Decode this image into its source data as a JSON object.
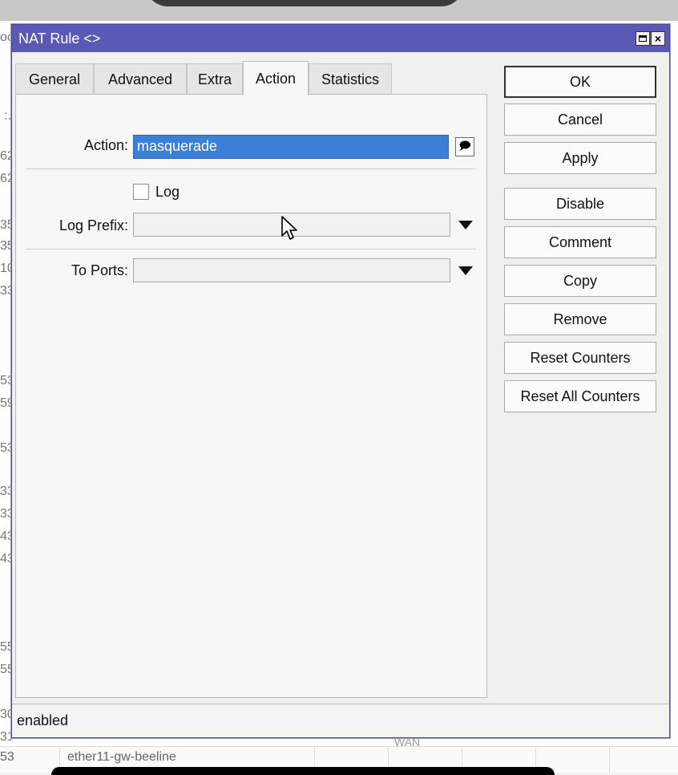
{
  "window": {
    "title": "NAT Rule <>",
    "close_glyph": "×"
  },
  "tabs": [
    {
      "label": "General",
      "active": false
    },
    {
      "label": "Advanced",
      "active": false
    },
    {
      "label": "Extra",
      "active": false
    },
    {
      "label": "Action",
      "active": true
    },
    {
      "label": "Statistics",
      "active": false
    }
  ],
  "form": {
    "action_label": "Action:",
    "action_value": "masquerade",
    "log_label": "Log",
    "log_checked": false,
    "log_prefix_label": "Log Prefix:",
    "log_prefix_value": "",
    "to_ports_label": "To Ports:",
    "to_ports_value": ""
  },
  "buttons": {
    "ok": "OK",
    "cancel": "Cancel",
    "apply": "Apply",
    "disable": "Disable",
    "comment": "Comment",
    "copy": "Copy",
    "remove": "Remove",
    "reset_counters": "Reset Counters",
    "reset_all_counters": "Reset All Counters"
  },
  "status": {
    "text": "enabled"
  },
  "background": {
    "left_stubs": [
      "oc",
      ":.",
      "62",
      "62",
      "35",
      "35",
      "10",
      "33",
      "53",
      "59",
      "53",
      "33",
      "33",
      "43",
      "43",
      "55",
      "55",
      "30",
      "31"
    ],
    "bottom_row": {
      "num": "53",
      "interface": "ether11-gw-beeline",
      "partial": "WAN"
    }
  },
  "colors": {
    "titlebar": "#5b59b5",
    "selection": "#3b7fd6"
  }
}
